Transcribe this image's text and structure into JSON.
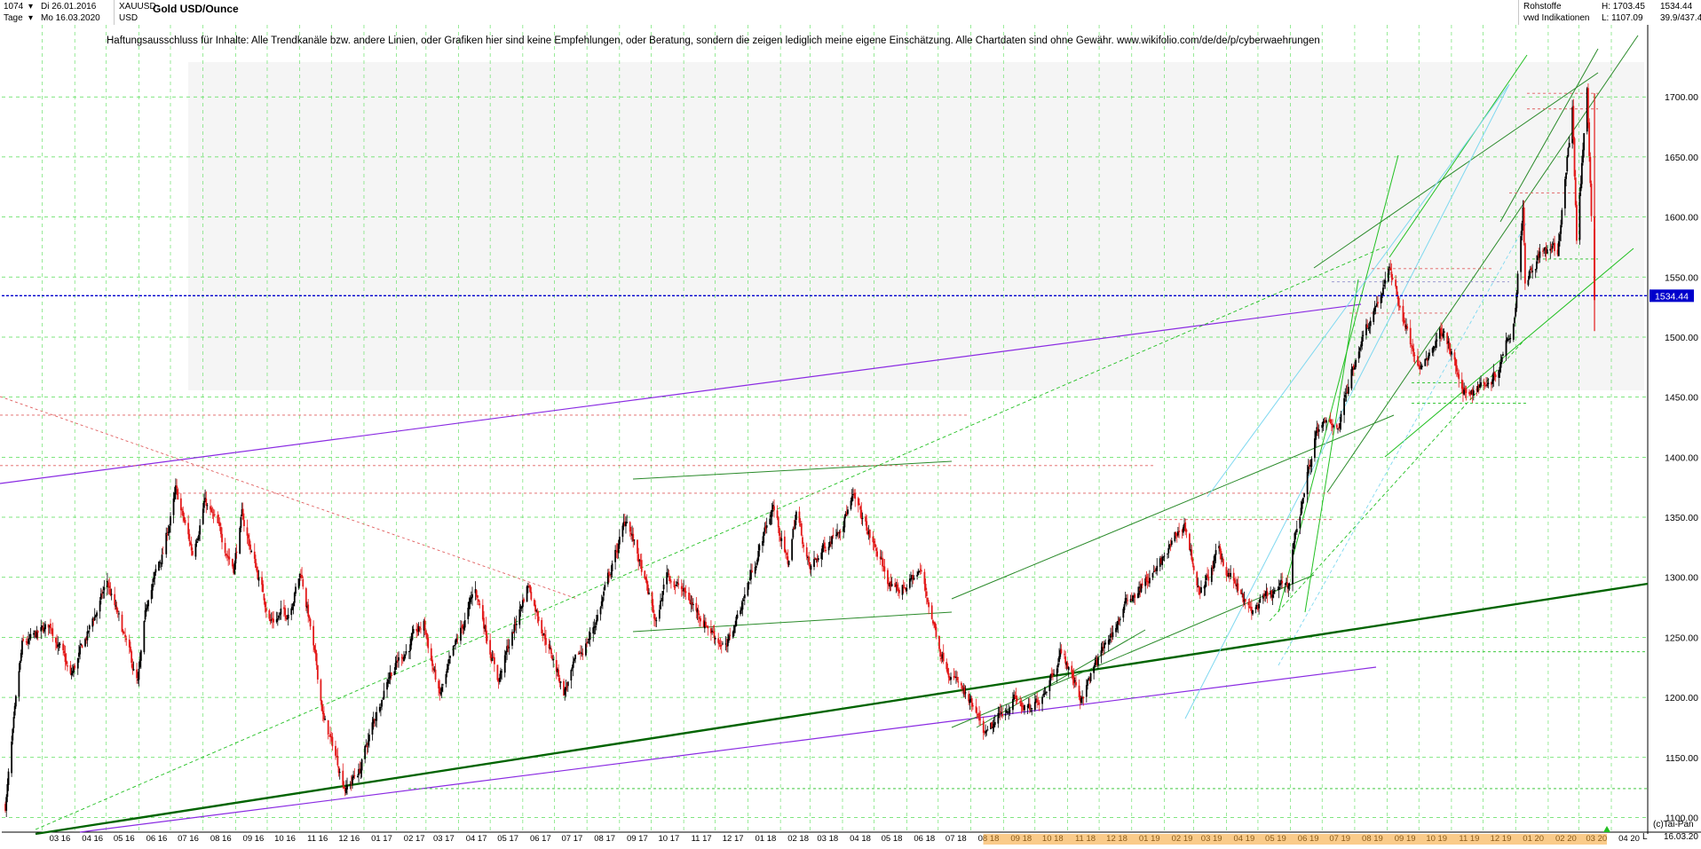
{
  "header": {
    "count": "1074",
    "start_date": "Di 26.01.2016",
    "interval": "Tage",
    "end_date": "Mo 16.03.2020",
    "symbol": "XAUUSD",
    "currency": "USD",
    "title": "Gold USD/Ounce",
    "category": "Rohstoffe",
    "source": "vwd Indikationen",
    "high_label": "H: 1703.45",
    "low_label": "L: 1107.09",
    "last_value": "1534.44",
    "ratio": "39.9/437.4"
  },
  "disclaimer": "Haftungsausschluss für Inhalte: Alle Trendkanäle bzw. andere Linien, oder Grafiken hier sind keine Empfehlungen, oder Beratung, sondern die zeigen lediglich meine eigene Einschätzung. Alle Chartdaten sind ohne Gewähr.  www.wikifolio.com/de/de/p/cyberwaehrungen",
  "footer": {
    "copyright": "(c)Tai-Pan",
    "date": "16.03.20",
    "axis_suffix": "L"
  },
  "colors": {
    "up_candle": "#000000",
    "down_candle": "#e31a1a",
    "channel_green": "#00a000",
    "support_dark_green": "#006400",
    "long_trend_purple": "#8a2be2",
    "cyan_line": "#7fd8f0",
    "last_price_line": "#0000cc",
    "grid": "#55dd55"
  },
  "chart_data": {
    "type": "candlestick",
    "title": "Gold USD/Ounce",
    "yrange": [
      1090,
      1760
    ],
    "y_ticks": [
      1100,
      1150,
      1200,
      1250,
      1300,
      1350,
      1400,
      1450,
      1500,
      1550,
      1600,
      1650,
      1700
    ],
    "y_tick_labels": [
      "1100.00",
      "1150.00",
      "1200.00",
      "1250.00",
      "1300.00",
      "1350.00",
      "1400.00",
      "1450.00",
      "1500.00",
      "1550.00",
      "1600.00",
      "1650.00",
      "1700.00"
    ],
    "x_tick_labels": [
      "03 16",
      "04 16",
      "05 16",
      "06 16",
      "07 16",
      "08 16",
      "09 16",
      "10 16",
      "11 16",
      "12 16",
      "01 17",
      "02 17",
      "03 17",
      "04 17",
      "05 17",
      "06 17",
      "07 17",
      "08 17",
      "09 17",
      "10 17",
      "11 17",
      "12 17",
      "01 18",
      "02 18",
      "03 18",
      "04 18",
      "05 18",
      "06 18",
      "07 18",
      "08 18",
      "09 18",
      "10 18",
      "11 18",
      "12 18",
      "01 19",
      "02 19",
      "03 19",
      "04 19",
      "05 19",
      "06 19",
      "07 19",
      "08 19",
      "09 19",
      "10 19",
      "11 19",
      "12 19",
      "01 20",
      "02 20",
      "03 20",
      "04 20"
    ],
    "price_path": [
      [
        "2016-01-26",
        1110
      ],
      [
        "2016-02-11",
        1240
      ],
      [
        "2016-03-10",
        1260
      ],
      [
        "2016-03-28",
        1215
      ],
      [
        "2016-05-02",
        1295
      ],
      [
        "2016-05-31",
        1210
      ],
      [
        "2016-06-10",
        1285
      ],
      [
        "2016-06-24",
        1320
      ],
      [
        "2016-07-06",
        1370
      ],
      [
        "2016-07-22",
        1320
      ],
      [
        "2016-08-02",
        1365
      ],
      [
        "2016-08-30",
        1310
      ],
      [
        "2016-09-07",
        1350
      ],
      [
        "2016-10-04",
        1265
      ],
      [
        "2016-10-20",
        1270
      ],
      [
        "2016-11-02",
        1305
      ],
      [
        "2016-11-09",
        1270
      ],
      [
        "2016-11-24",
        1180
      ],
      [
        "2016-12-15",
        1125
      ],
      [
        "2016-12-28",
        1140
      ],
      [
        "2017-01-24",
        1220
      ],
      [
        "2017-02-27",
        1260
      ],
      [
        "2017-03-14",
        1200
      ],
      [
        "2017-04-17",
        1290
      ],
      [
        "2017-05-09",
        1215
      ],
      [
        "2017-06-06",
        1295
      ],
      [
        "2017-07-10",
        1205
      ],
      [
        "2017-08-08",
        1260
      ],
      [
        "2017-09-08",
        1350
      ],
      [
        "2017-10-06",
        1260
      ],
      [
        "2017-10-16",
        1305
      ],
      [
        "2017-12-12",
        1240
      ],
      [
        "2018-01-25",
        1360
      ],
      [
        "2018-02-08",
        1310
      ],
      [
        "2018-02-16",
        1355
      ],
      [
        "2018-03-01",
        1305
      ],
      [
        "2018-04-11",
        1365
      ],
      [
        "2018-05-21",
        1285
      ],
      [
        "2018-06-14",
        1305
      ],
      [
        "2018-07-03",
        1240
      ],
      [
        "2018-08-16",
        1165
      ],
      [
        "2018-09-10",
        1200
      ],
      [
        "2018-09-28",
        1185
      ],
      [
        "2018-10-26",
        1240
      ],
      [
        "2018-11-13",
        1200
      ],
      [
        "2018-12-31",
        1285
      ],
      [
        "2019-01-25",
        1305
      ],
      [
        "2019-02-20",
        1345
      ],
      [
        "2019-03-07",
        1285
      ],
      [
        "2019-03-25",
        1320
      ],
      [
        "2019-04-23",
        1270
      ],
      [
        "2019-05-31",
        1295
      ],
      [
        "2019-06-03",
        1325
      ],
      [
        "2019-06-25",
        1420
      ],
      [
        "2019-07-17",
        1430
      ],
      [
        "2019-08-07",
        1500
      ],
      [
        "2019-09-04",
        1555
      ],
      [
        "2019-10-01",
        1470
      ],
      [
        "2019-10-25",
        1510
      ],
      [
        "2019-11-12",
        1450
      ],
      [
        "2019-12-13",
        1470
      ],
      [
        "2019-12-31",
        1520
      ],
      [
        "2020-01-08",
        1612
      ],
      [
        "2020-01-10",
        1550
      ],
      [
        "2020-01-24",
        1570
      ],
      [
        "2020-02-10",
        1570
      ],
      [
        "2020-02-24",
        1690
      ],
      [
        "2020-02-28",
        1585
      ],
      [
        "2020-03-09",
        1703
      ],
      [
        "2020-03-16",
        1534
      ]
    ]
  }
}
